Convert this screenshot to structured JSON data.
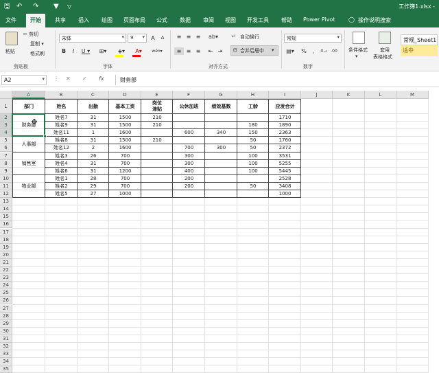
{
  "titlebar": {
    "save_icon": "🖫",
    "undo_icon": "↶",
    "redo_icon": "↷",
    "filter_icon": "▼",
    "customize_icon": "▽",
    "title": "工作簿1.xlsx -"
  },
  "tabs": [
    "文件",
    "开始",
    "共享",
    "插入",
    "绘图",
    "页面布局",
    "公式",
    "数据",
    "审阅",
    "视图",
    "开发工具",
    "帮助",
    "Power Pivot",
    "操作说明搜索"
  ],
  "ribbon": {
    "paste": "粘贴",
    "cut": "✂ 剪切",
    "copy": "复制 ▾",
    "format_painter": "格式刷",
    "font_name": "宋体",
    "font_size": "9",
    "bold": "B",
    "italic": "I",
    "underline": "U ▾",
    "wrap_text": "自动换行",
    "merge_center": "合并后居中",
    "number_format": "常规",
    "percent": "%",
    "comma": ",",
    "cond_format": "条件格式",
    "table_format_1": "套用",
    "table_format_2": "表格格式",
    "style_normal": "常规_Sheet1",
    "style_medium": "适中",
    "groups": {
      "clipboard": "剪贴板",
      "font": "字体",
      "alignment": "对齐方式",
      "number": "数字"
    }
  },
  "formula_bar": {
    "name_box": "A2",
    "cancel": "✕",
    "enter": "✓",
    "fx": "fx",
    "value": "财务部"
  },
  "columns": [
    "A",
    "B",
    "C",
    "D",
    "E",
    "F",
    "G",
    "H",
    "I",
    "J",
    "K",
    "L",
    "M"
  ],
  "rows": [
    "1",
    "2",
    "3",
    "4",
    "5",
    "6",
    "7",
    "8",
    "9",
    "10",
    "11",
    "12",
    "13",
    "14",
    "15",
    "16",
    "17",
    "18",
    "19",
    "20",
    "21",
    "22",
    "23",
    "24",
    "25",
    "26",
    "27",
    "28",
    "29",
    "30",
    "31",
    "32",
    "33",
    "34",
    "35"
  ],
  "header_row": [
    "部门",
    "姓名",
    "出勤",
    "基本工资",
    "岗位\n津贴",
    "公休加班",
    "绩效基数",
    "工龄",
    "应发合计"
  ],
  "departments": [
    "财务部",
    "人事部",
    "销售室",
    "物业部"
  ],
  "data_rows": [
    [
      "姓名7",
      "31",
      "1500",
      "210",
      "",
      "",
      "",
      "1710"
    ],
    [
      "姓名9",
      "31",
      "1500",
      "210",
      "",
      "",
      "180",
      "1890"
    ],
    [
      "姓名11",
      "1",
      "1600",
      "",
      "600",
      "340",
      "150",
      "2363"
    ],
    [
      "姓名8",
      "31",
      "1500",
      "210",
      "",
      "",
      "50",
      "1760"
    ],
    [
      "姓名12",
      "2",
      "1600",
      "",
      "700",
      "300",
      "50",
      "2372"
    ],
    [
      "姓名3",
      "26",
      "700",
      "",
      "300",
      "",
      "100",
      "3531"
    ],
    [
      "姓名4",
      "31",
      "700",
      "",
      "300",
      "",
      "100",
      "5255"
    ],
    [
      "姓名6",
      "31",
      "1200",
      "",
      "400",
      "",
      "100",
      "5445"
    ],
    [
      "姓名1",
      "28",
      "700",
      "",
      "200",
      "",
      "",
      "2528"
    ],
    [
      "姓名2",
      "29",
      "700",
      "",
      "200",
      "",
      "50",
      "3408"
    ],
    [
      "姓名5",
      "27",
      "1000",
      "",
      "",
      "",
      "",
      "1000"
    ]
  ]
}
